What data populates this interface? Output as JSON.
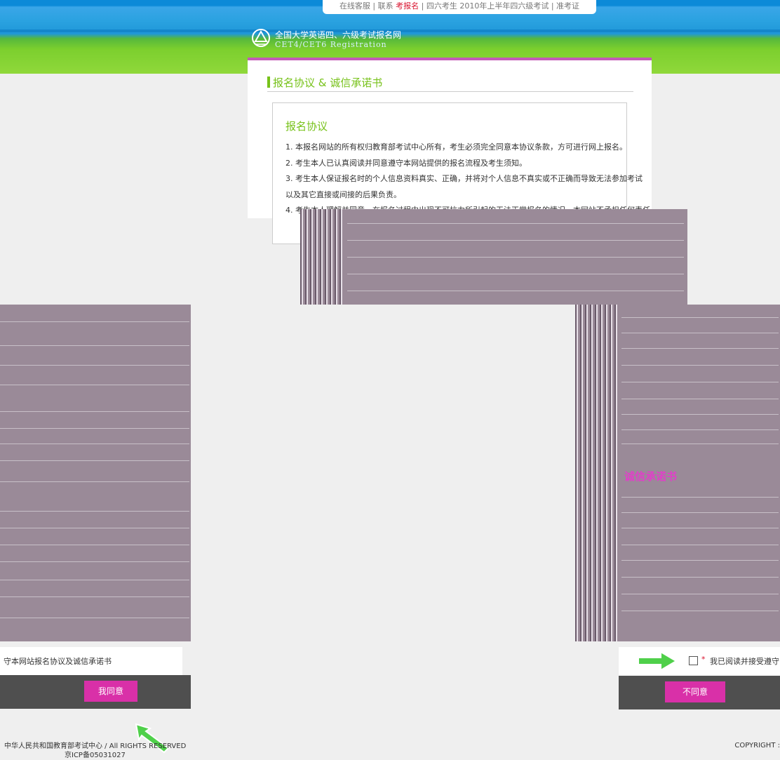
{
  "topnav": {
    "items": [
      "在线客服",
      "联系",
      "考报名",
      "四六考生",
      "2010年上半年四六级考试",
      "准考证"
    ]
  },
  "site": {
    "title_cn": "全国大学英语四、六级考试报名网",
    "title_en": "CET4/CET6 Registration"
  },
  "panel": {
    "title": "报名协议 & 诚信承诺书"
  },
  "agreement": {
    "heading": "报名协议",
    "items": [
      "1. 本报名网站的所有权归教育部考试中心所有，考生必须完全同意本协议条款，方可进行网上报名。",
      "2. 考生本人已认真阅读并同意遵守本网站提供的报名流程及考生须知。",
      "3. 考生本人保证报名时的个人信息资料真实、正确，并将对个人信息不真实或不正确而导致无法参加考试",
      "以及其它直接或间接的后果负责。",
      "4. 考生本人理解并同意，在报名过程中出现不可抗力所引起的无法正常报名的情况，本网站不承担任何责任"
    ]
  },
  "vow": {
    "heading": "诚信承诺书"
  },
  "accept": {
    "left_label": "守本网站报名协议及诚信承诺书",
    "right_star": "*",
    "right_label": "我已阅读并接受遵守"
  },
  "buttons": {
    "agree": "我同意",
    "disagree": "不同意"
  },
  "footer": {
    "copyright_left": "中华人民共和国教育部考试中心 / All RIGHTS RESERVED",
    "icp": "京ICP备05031027",
    "copyright_right": "COPYRIGHT : "
  },
  "colors": {
    "accent_green": "#77c21a",
    "accent_pink": "#d930a8",
    "header_blue": "#1f97d8"
  }
}
